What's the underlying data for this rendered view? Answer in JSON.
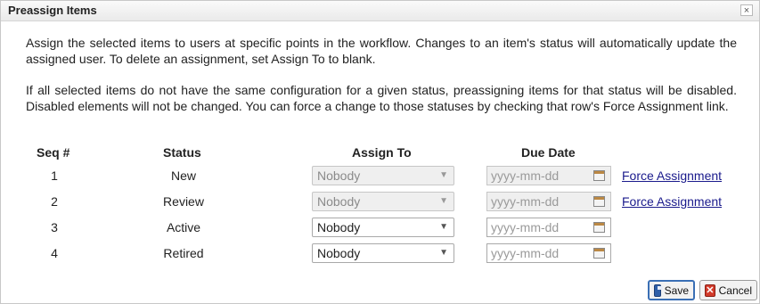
{
  "dialog": {
    "title": "Preassign Items",
    "close_glyph": "×",
    "close_icon": "close-icon"
  },
  "intro": {
    "paragraph1": "Assign the selected items to users at specific points in the workflow. Changes to an item's status will automatically update the assigned user. To delete an assignment, set Assign To to blank.",
    "paragraph2": "If all selected items do not have the same configuration for a given status, preassigning items for that status will be disabled. Disabled elements will not be changed. You can force a change to those statuses by checking that row's Force Assignment link."
  },
  "table": {
    "headers": {
      "seq": "Seq #",
      "status": "Status",
      "assign_to": "Assign To",
      "due_date": "Due Date"
    },
    "rows": [
      {
        "seq": "1",
        "status": "New",
        "assign_to": "Nobody",
        "due_placeholder": "yyyy-mm-dd",
        "disabled": true,
        "force_label": "Force Assignment"
      },
      {
        "seq": "2",
        "status": "Review",
        "assign_to": "Nobody",
        "due_placeholder": "yyyy-mm-dd",
        "disabled": true,
        "force_label": "Force Assignment"
      },
      {
        "seq": "3",
        "status": "Active",
        "assign_to": "Nobody",
        "due_placeholder": "yyyy-mm-dd",
        "disabled": false
      },
      {
        "seq": "4",
        "status": "Retired",
        "assign_to": "Nobody",
        "due_placeholder": "yyyy-mm-dd",
        "disabled": false
      }
    ]
  },
  "footer": {
    "save_label": "Save",
    "cancel_label": "Cancel",
    "save_icon": "floppy-disk-icon",
    "cancel_icon": "x-icon"
  },
  "colors": {
    "link": "#1a1a8c",
    "primary_border": "#3a6fb5",
    "cancel_icon": "#d23b2b"
  }
}
